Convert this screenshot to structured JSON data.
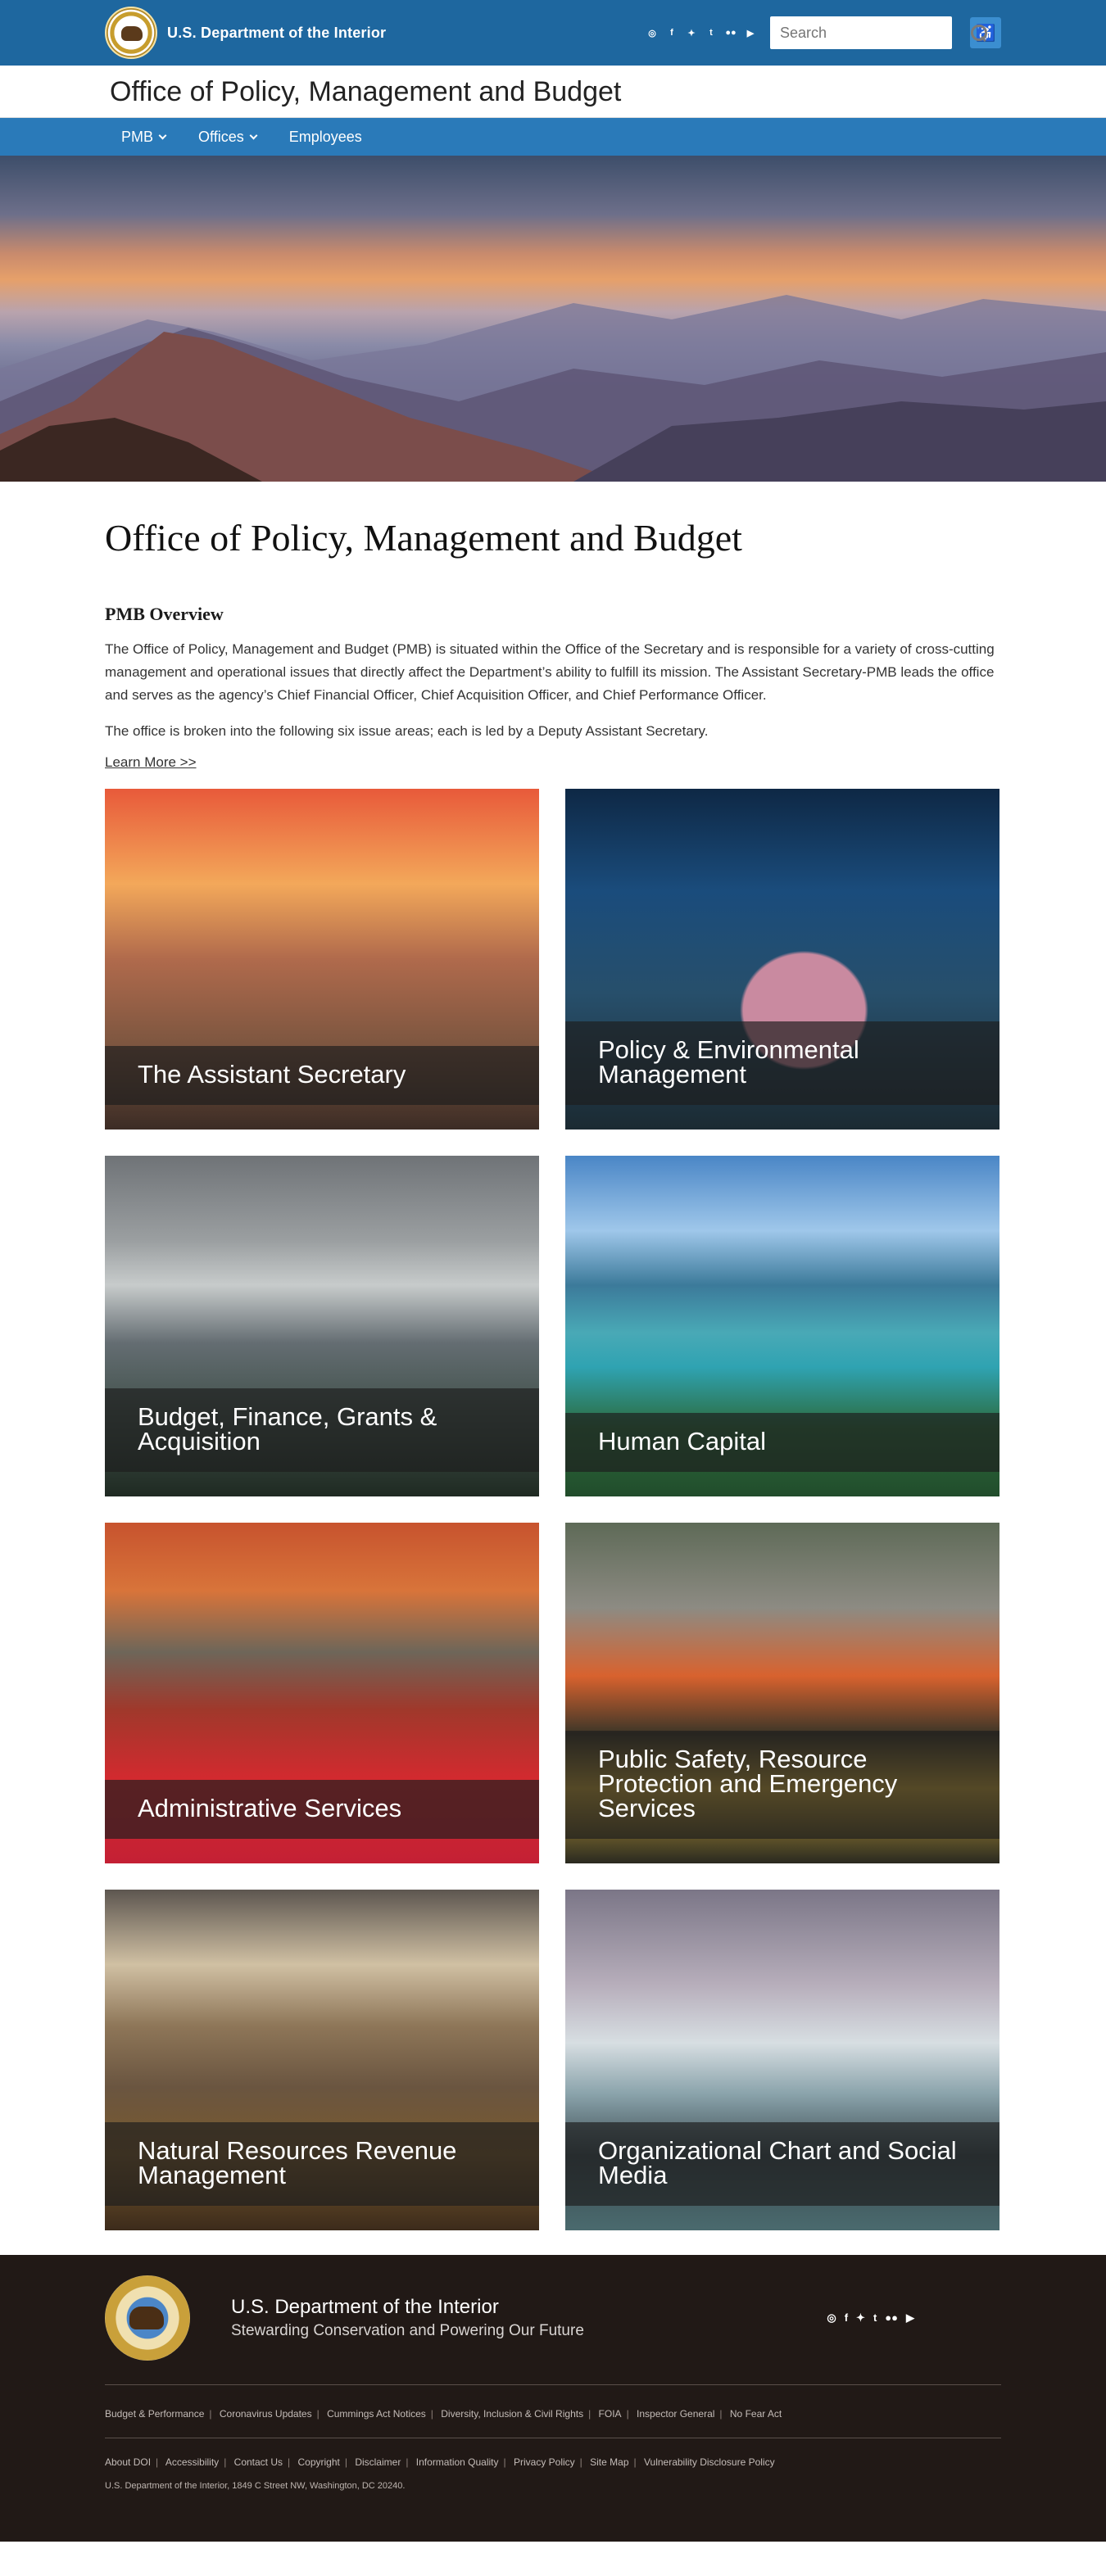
{
  "header": {
    "agency": "U.S. Department of the Interior",
    "search_placeholder": "Search",
    "social": [
      "instagram-icon",
      "facebook-icon",
      "twitter-icon",
      "tumblr-icon",
      "flickr-icon",
      "youtube-icon"
    ]
  },
  "office_bar": {
    "title": "Office of Policy, Management and Budget"
  },
  "nav": {
    "items": [
      {
        "label": "PMB",
        "dropdown": true
      },
      {
        "label": "Offices",
        "dropdown": true
      },
      {
        "label": "Employees",
        "dropdown": false
      }
    ]
  },
  "main": {
    "title": "Office of Policy, Management and Budget",
    "overview_heading": "PMB Overview",
    "paragraph1": "The Office of Policy, Management and Budget (PMB) is situated within the Office of the Secretary and is responsible for a variety of cross-cutting management and operational issues that directly affect the Department’s ability to fulfill its mission. The Assistant Secretary-PMB leads the office and serves as the agency’s Chief Financial Officer, Chief Acquisition Officer, and Chief Performance Officer.",
    "paragraph2": "The office is broken into the following six issue areas; each is led by a Deputy Assistant Secretary.",
    "learn_more": "Learn More >>",
    "cards": [
      {
        "title": "The Assistant Secretary"
      },
      {
        "title": "Policy & Environmental Management"
      },
      {
        "title": "Budget, Finance, Grants & Acquisition"
      },
      {
        "title": "Human Capital"
      },
      {
        "title": "Administrative Services"
      },
      {
        "title": "Public Safety, Resource Protection and Emergency Services"
      },
      {
        "title": "Natural Resources Revenue Management"
      },
      {
        "title": "Organizational Chart and Social Media"
      }
    ]
  },
  "footer": {
    "name": "U.S. Department of the Interior",
    "tagline": "Stewarding Conservation and Powering Our Future",
    "links1": [
      "Budget & Performance",
      "Coronavirus Updates",
      "Cummings Act Notices",
      "Diversity, Inclusion & Civil Rights",
      "FOIA",
      "Inspector General",
      "No Fear Act"
    ],
    "links2": [
      "About DOI",
      "Accessibility",
      "Contact Us",
      "Copyright",
      "Disclaimer",
      "Information Quality",
      "Privacy Policy",
      "Site Map",
      "Vulnerability Disclosure Policy"
    ],
    "address": "U.S. Department of the Interior, 1849 C Street NW, Washington, DC 20240."
  }
}
